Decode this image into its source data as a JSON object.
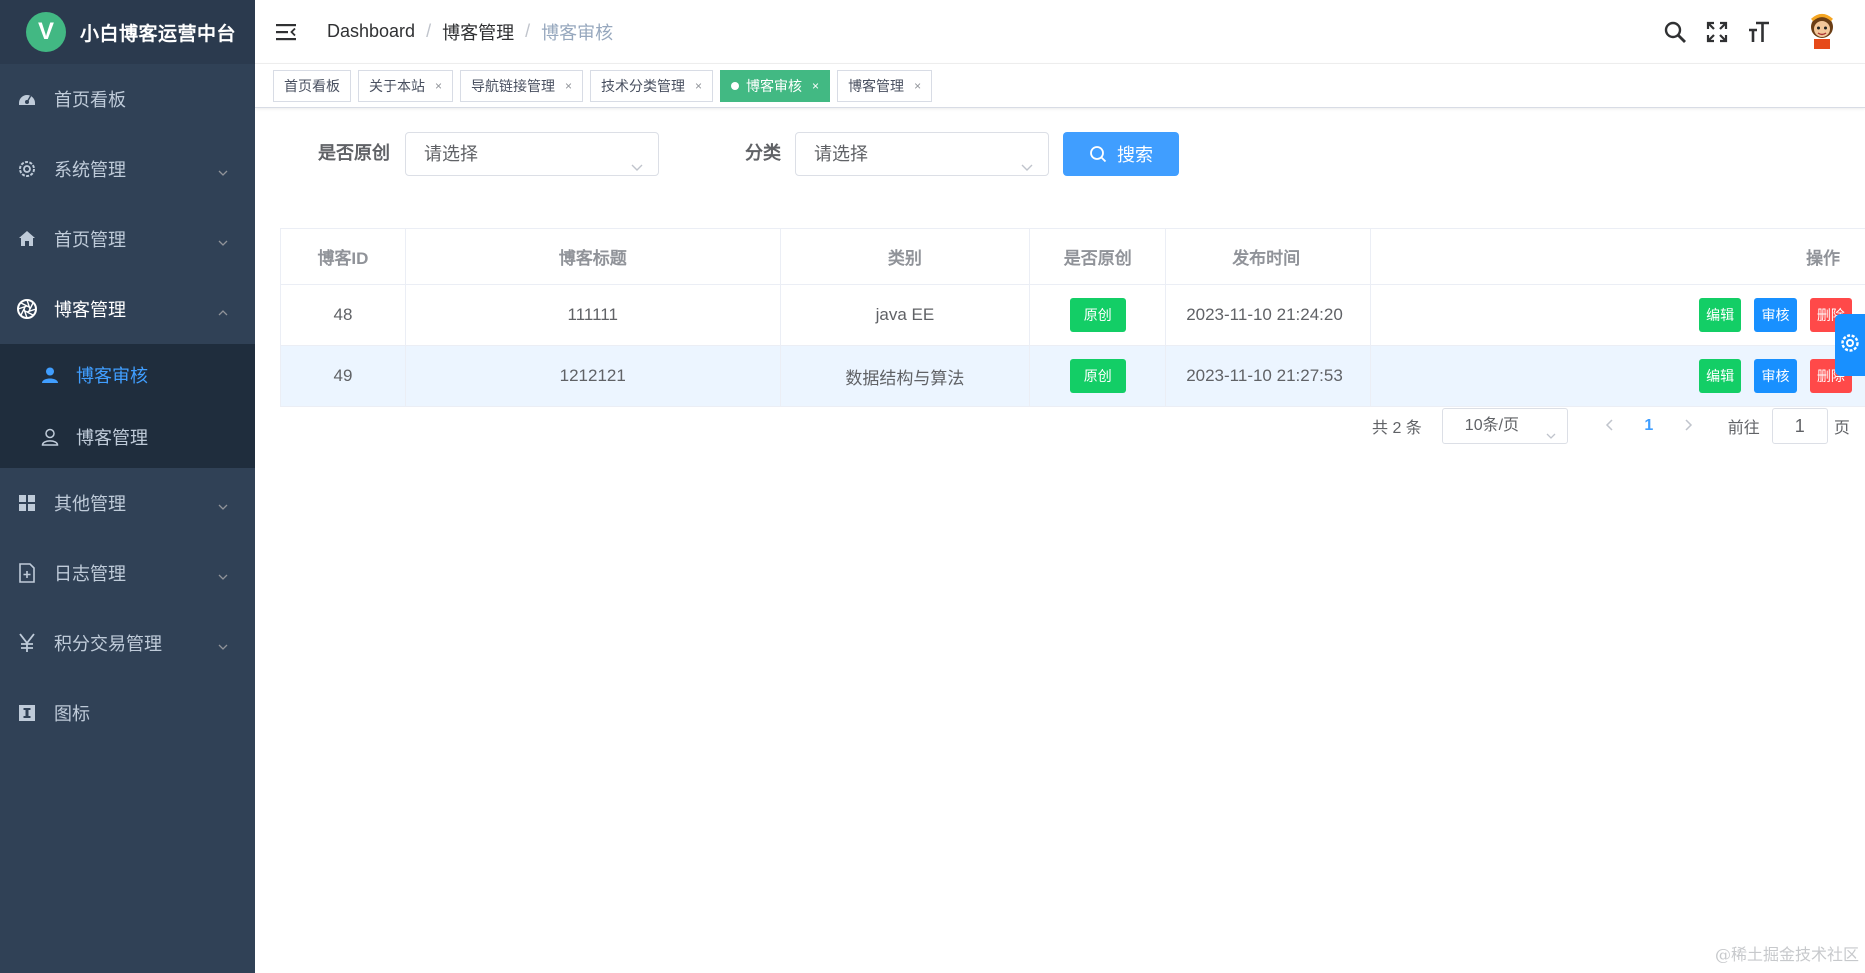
{
  "app": {
    "title": "小白博客运营中台",
    "logo_letter": "V"
  },
  "sidebar": {
    "items": [
      {
        "label": "首页看板",
        "icon": "dashboard-icon",
        "has_children": false
      },
      {
        "label": "系统管理",
        "icon": "gear-icon",
        "has_children": true
      },
      {
        "label": "首页管理",
        "icon": "home-icon",
        "has_children": true
      },
      {
        "label": "博客管理",
        "icon": "aperture-icon",
        "has_children": true,
        "open": true,
        "children": [
          {
            "label": "博客审核",
            "icon": "user-icon",
            "active": true
          },
          {
            "label": "博客管理",
            "icon": "user-outline-icon",
            "active": false
          }
        ]
      },
      {
        "label": "其他管理",
        "icon": "grid-icon",
        "has_children": true
      },
      {
        "label": "日志管理",
        "icon": "document-add-icon",
        "has_children": true
      },
      {
        "label": "积分交易管理",
        "icon": "yen-icon",
        "has_children": true
      },
      {
        "label": "图标",
        "icon": "info-icon",
        "has_children": false
      }
    ]
  },
  "header": {
    "breadcrumb": [
      "Dashboard",
      "博客管理",
      "博客审核"
    ],
    "breadcrumb_separator": "/"
  },
  "tags": [
    {
      "label": "首页看板",
      "closable": false,
      "active": false
    },
    {
      "label": "关于本站",
      "closable": true,
      "active": false
    },
    {
      "label": "导航链接管理",
      "closable": true,
      "active": false
    },
    {
      "label": "技术分类管理",
      "closable": true,
      "active": false
    },
    {
      "label": "博客审核",
      "closable": true,
      "active": true
    },
    {
      "label": "博客管理",
      "closable": true,
      "active": false
    }
  ],
  "tag_close_glyph": "×",
  "search": {
    "original_label": "是否原创",
    "original_placeholder": "请选择",
    "category_label": "分类",
    "category_placeholder": "请选择",
    "button_label": "搜索"
  },
  "table": {
    "columns": [
      "博客ID",
      "博客标题",
      "类别",
      "是否原创",
      "发布时间",
      "操作"
    ],
    "rows": [
      {
        "id": "48",
        "title": "111111",
        "category": "java EE",
        "original": "原创",
        "time": "2023-11-10 21:24:20"
      },
      {
        "id": "49",
        "title": "1212121",
        "category": "数据结构与算法",
        "original": "原创",
        "time": "2023-11-10 21:27:53"
      }
    ],
    "actions": {
      "edit": "编辑",
      "audit": "审核",
      "delete": "删除"
    }
  },
  "pagination": {
    "total_text": "共 2 条",
    "page_size": "10条/页",
    "current_page": "1",
    "goto_label": "前往",
    "goto_value": "1",
    "page_suffix": "页"
  },
  "colors": {
    "sidebar_bg": "#304156",
    "active_tag": "#42b983",
    "primary": "#409eff",
    "success": "#13ce66",
    "danger": "#ff4949"
  },
  "watermark": "@稀土掘金技术社区"
}
